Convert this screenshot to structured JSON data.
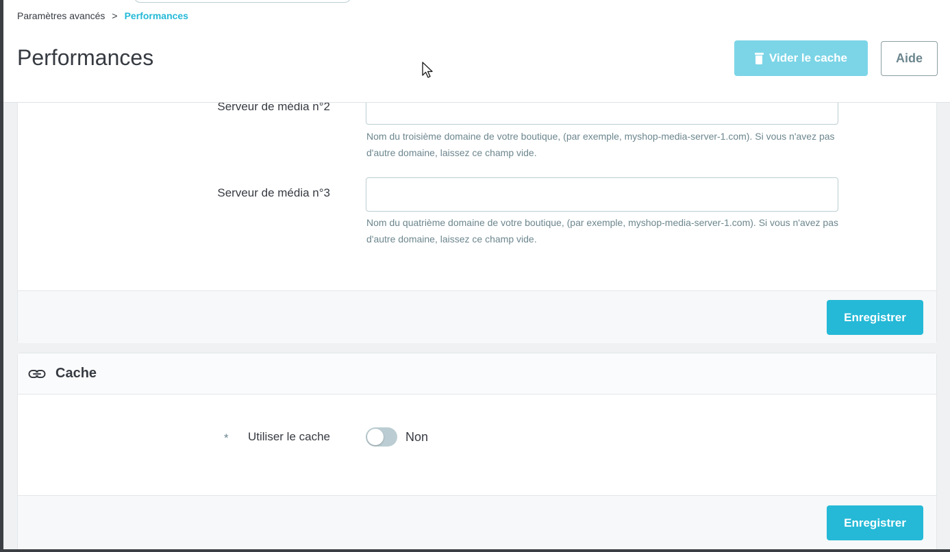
{
  "breadcrumb": {
    "parent": "Paramètres avancés",
    "separator": ">",
    "current": "Performances"
  },
  "header": {
    "title": "Performances",
    "clear_cache_label": "Vider le cache",
    "help_label": "Aide"
  },
  "media_servers": {
    "server2_label": "Serveur de média n°2",
    "server2_value": "",
    "server2_help": "Nom du troisième domaine de votre boutique, (par exemple, myshop-media-server-1.com). Si vous n'avez pas d'autre domaine, laissez ce champ vide.",
    "server3_label": "Serveur de média n°3",
    "server3_value": "",
    "server3_help": "Nom du quatrième domaine de votre boutique, (par exemple, myshop-media-server-1.com). Si vous n'avez pas d'autre domaine, laissez ce champ vide.",
    "save_label": "Enregistrer"
  },
  "cache": {
    "title": "Cache",
    "use_cache_label": "Utiliser le cache",
    "required_marker": "*",
    "use_cache_state": "Non",
    "save_label": "Enregistrer"
  },
  "colors": {
    "accent": "#25b9d7",
    "accent_light": "#7cd5e7",
    "text": "#363a41",
    "muted": "#6c868e"
  },
  "icons": {
    "clear_cache": "trash-icon",
    "cache_section": "link-icon"
  }
}
